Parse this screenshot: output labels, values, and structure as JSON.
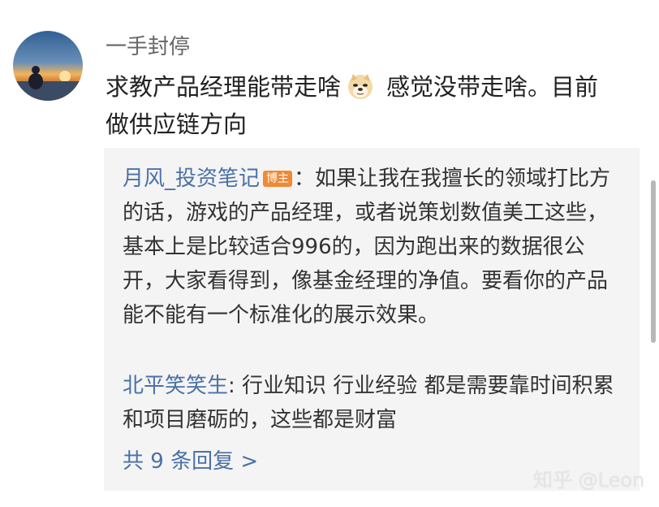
{
  "comment": {
    "username": "一手封停",
    "text_part1": "求教产品经理能带走啥",
    "emoji_icon": "doge-emoji-icon",
    "text_part2": "感觉没带走啥。目前\n做供应链方向"
  },
  "replies": [
    {
      "name": "月风_投资笔记",
      "badge": "博主",
      "separator": "：",
      "text": "如果让我在我擅长的领域打比方的话，游戏的产品经理，或者说策划数值美工这些，基本上是比较适合996的，因为跑出来的数据很公开，大家看得到，像基金经理的净值。要看你的产品能不能有一个标准化的展示效果。"
    },
    {
      "name": "北平笑笑生",
      "separator": ": ",
      "text": "行业知识 行业经验 都是需要靠时间积累和项目磨砺的，这些都是财富"
    }
  ],
  "total_replies_label": "共 9 条回复 >",
  "watermark": "知乎 @Leon",
  "colors": {
    "link": "#4b71a6",
    "badge": "#f08a36",
    "reply_bg": "#f4f4f4"
  }
}
